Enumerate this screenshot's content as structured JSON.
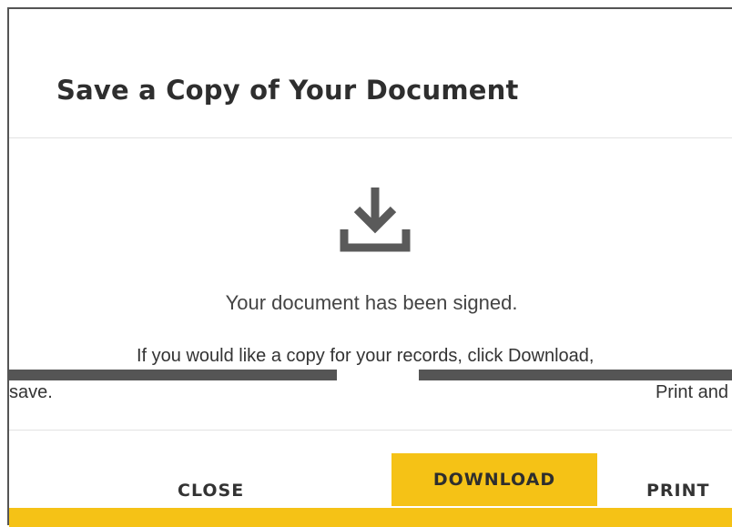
{
  "dialog": {
    "title": "Save a Copy of Your Document",
    "icon": "download-icon",
    "message_line1": "Your document has been signed.",
    "message_line2": "If you would like a copy for your records, click Download,",
    "message_line3": "save.",
    "message_line4": "Print and",
    "buttons": {
      "close_label": "CLOSE",
      "download_label": "DOWNLOAD",
      "print_label": "PRINT"
    },
    "colors": {
      "accent": "#f5c216",
      "title_text": "#2e2e2e",
      "icon": "#5a5a5a"
    }
  }
}
